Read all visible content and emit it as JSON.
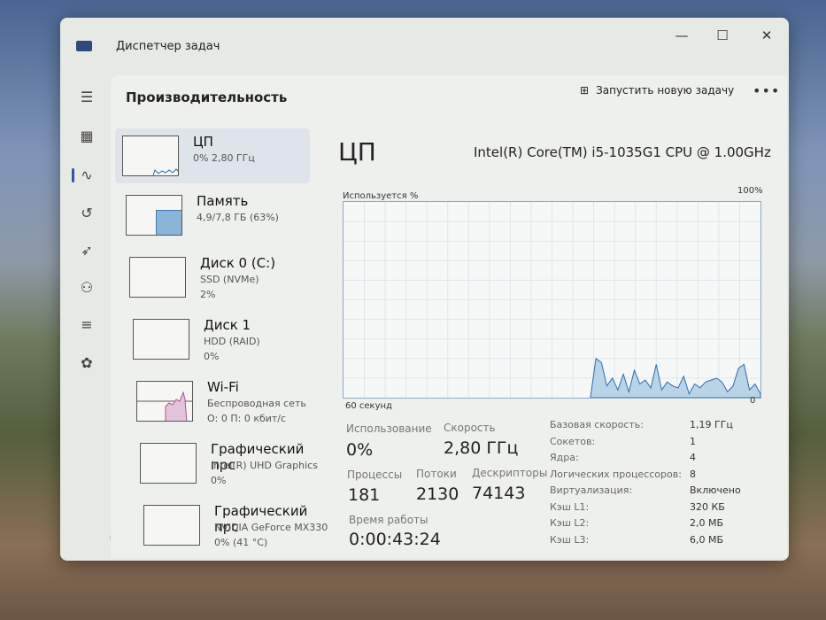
{
  "window": {
    "title": "Диспетчер задач",
    "minimize": "—",
    "maximize": "☐",
    "close": "✕"
  },
  "header": {
    "title": "Производительность",
    "new_task": "Запустить новую задачу",
    "more": "•••"
  },
  "devices": [
    {
      "name": "ЦП",
      "sub1": "0% 2,80 ГГц",
      "sub2": ""
    },
    {
      "name": "Память",
      "sub1": "4,9/7,8 ГБ (63%)",
      "sub2": ""
    },
    {
      "name": "Диск 0 (C:)",
      "sub1": "SSD (NVMe)",
      "sub2": "2%"
    },
    {
      "name": "Диск 1",
      "sub1": "HDD (RAID)",
      "sub2": "0%"
    },
    {
      "name": "Wi-Fi",
      "sub1": "Беспроводная сеть",
      "sub2": "О: 0 П: 0 кбит/с"
    },
    {
      "name": "Графический прс",
      "sub1": "Intel(R) UHD Graphics",
      "sub2": "0%"
    },
    {
      "name": "Графический прс",
      "sub1": "NVIDIA GeForce MX330",
      "sub2": "0% (41 °C)"
    }
  ],
  "cpu": {
    "title": "ЦП",
    "model": "Intel(R) Core(TM) i5-1035G1 CPU @ 1.00GHz",
    "graph_label": "Используется %",
    "max_label": "100%",
    "time_label": "60 секунд",
    "min_label": "0",
    "usage_series": [
      0,
      0,
      0,
      0,
      0,
      0,
      0,
      0,
      0,
      0,
      0,
      0,
      0,
      0,
      0,
      0,
      0,
      0,
      0,
      0,
      0,
      0,
      0,
      0,
      0,
      0,
      0,
      0,
      0,
      0,
      0,
      0,
      0,
      0,
      0,
      0,
      0,
      0,
      0,
      0,
      0,
      0,
      0,
      0,
      0,
      0,
      20,
      18,
      6,
      10,
      4,
      12,
      3,
      14,
      7,
      9,
      5,
      17,
      4,
      8,
      6,
      5,
      11,
      2,
      7,
      5,
      8,
      9,
      10,
      8,
      3,
      6,
      15,
      17,
      4,
      7,
      2
    ]
  },
  "stats": {
    "usage_label": "Использование",
    "usage": "0%",
    "speed_label": "Скорость",
    "speed": "2,80 ГГц",
    "proc_label": "Процессы",
    "proc": "181",
    "threads_label": "Потоки",
    "threads": "2130",
    "handles_label": "Дескрипторы",
    "handles": "74143",
    "uptime_label": "Время работы",
    "uptime": "0:00:43:24"
  },
  "specs": [
    {
      "k": "Базовая скорость:",
      "v": "1,19 ГГц"
    },
    {
      "k": "Сокетов:",
      "v": "1"
    },
    {
      "k": "Ядра:",
      "v": "4"
    },
    {
      "k": "Логических процессоров:",
      "v": "8"
    },
    {
      "k": "Виртуализация:",
      "v": "Включено"
    },
    {
      "k": "Кэш L1:",
      "v": "320 КБ"
    },
    {
      "k": "Кэш L2:",
      "v": "2,0 МБ"
    },
    {
      "k": "Кэш L3:",
      "v": "6,0 МБ"
    }
  ],
  "colors": {
    "cpu": "#2d6fb0",
    "memory": "#8ab4d8",
    "wifi": "#a8538f",
    "graph_fill": "#b8d4e6"
  }
}
